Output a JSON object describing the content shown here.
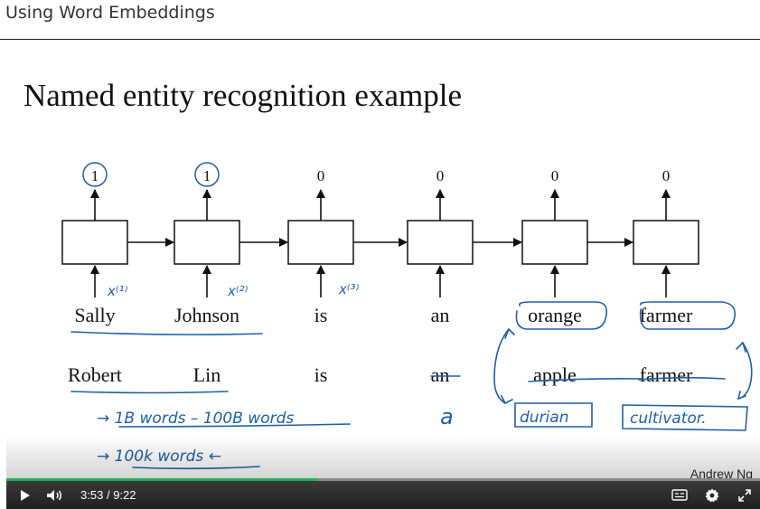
{
  "lesson": {
    "title": "Using Word Embeddings"
  },
  "slide": {
    "title": "Named entity recognition example",
    "outputs": [
      "1",
      "1",
      "0",
      "0",
      "0",
      "0"
    ],
    "inputs": [
      "x⁽¹⁾",
      "x⁽²⁾",
      "x⁽³⁾"
    ],
    "sentence1": [
      "Sally",
      "Johnson",
      "is",
      "an",
      "orange",
      "farmer"
    ],
    "sentence2": [
      "Robert",
      "Lin",
      "is",
      "an",
      "apple",
      "farmer"
    ],
    "handwritten": {
      "replacement_article": "a",
      "replacement_fruit": "durian",
      "replacement_job": "cultivator.",
      "note1": "→ 1B words – 100B words",
      "note2": "→ 100k words ←"
    },
    "watermark": "Andrew Ng"
  },
  "player": {
    "current_time": "3:53",
    "separator": "/",
    "duration": "9:22",
    "progress_fraction": 0.414,
    "accent": "#25b05d"
  }
}
